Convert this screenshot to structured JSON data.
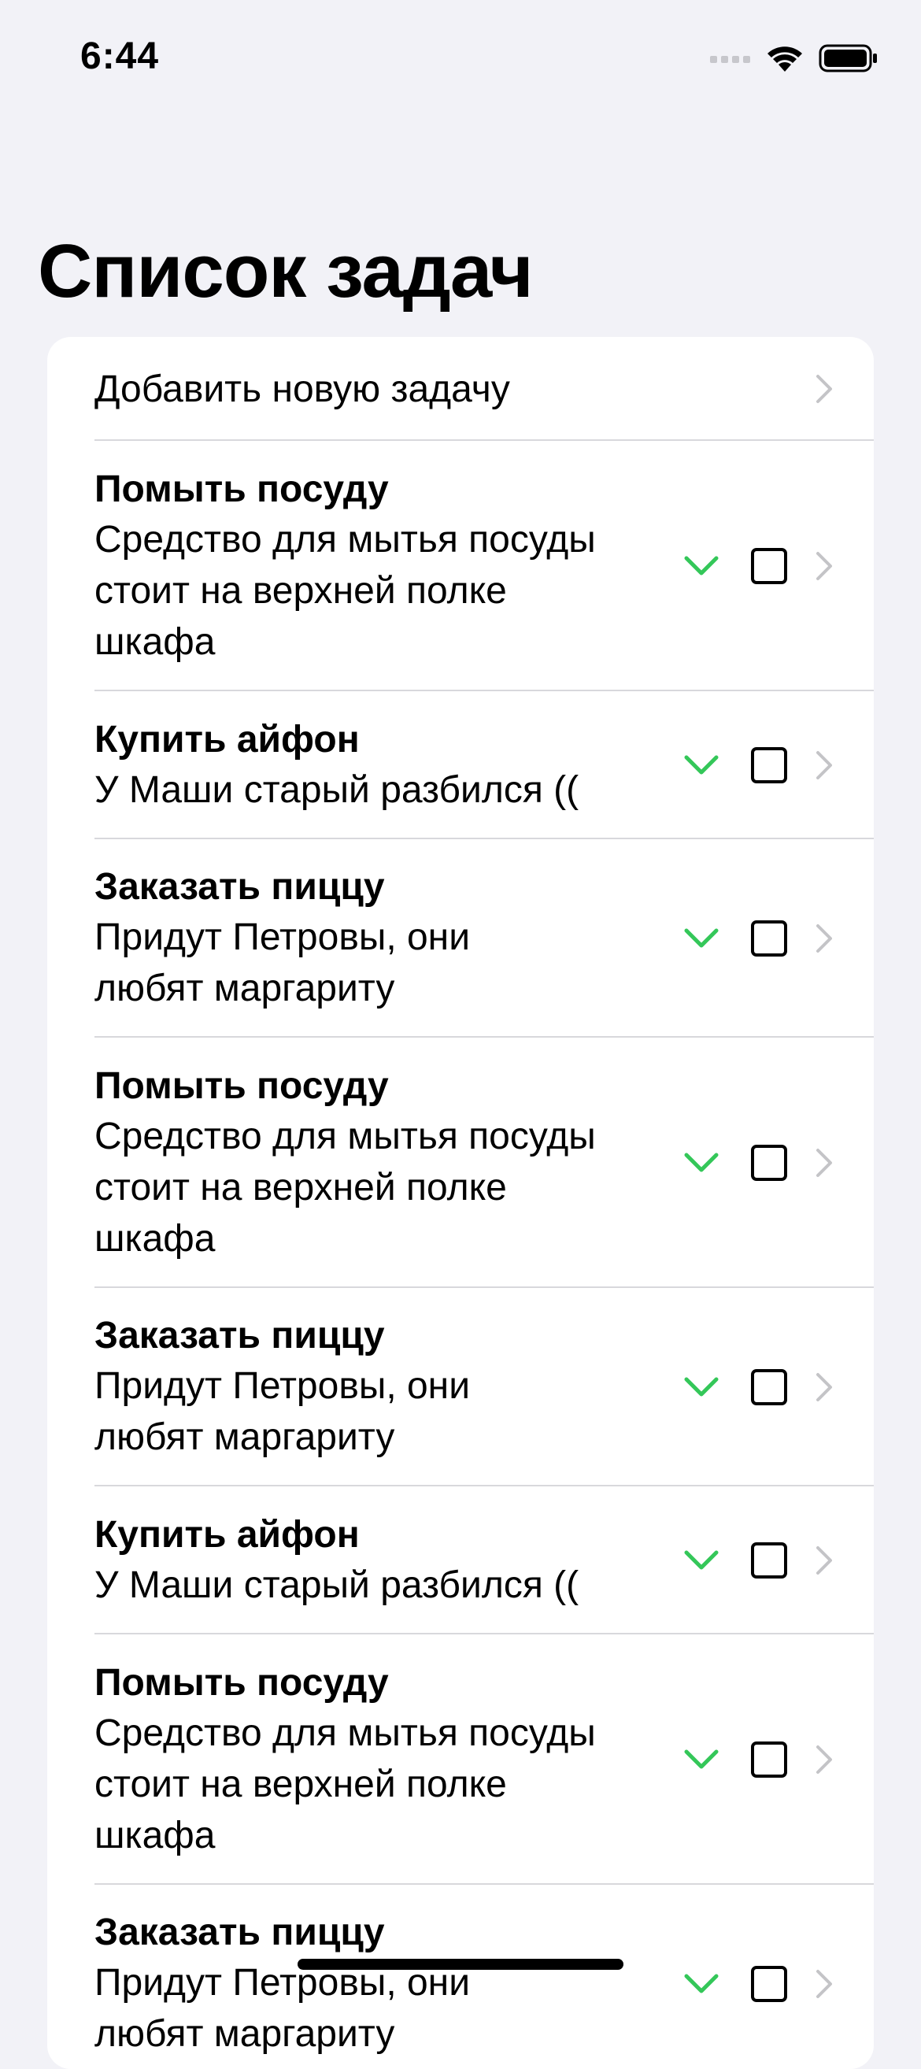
{
  "status_bar": {
    "time": "6:44"
  },
  "page": {
    "title": "Список задач"
  },
  "list": {
    "add_label": "Добавить новую задачу",
    "tasks": [
      {
        "title": "Помыть посуду",
        "description": "Средство для мытья посуды\nстоит на верхней полке\nшкафа",
        "checked": false
      },
      {
        "title": "Купить айфон",
        "description": "У Маши старый разбился ((",
        "checked": false
      },
      {
        "title": "Заказать пиццу",
        "description": "Придут Петровы, они\nлюбят маргариту",
        "checked": false
      },
      {
        "title": "Помыть посуду",
        "description": "Средство для мытья посуды\nстоит на верхней полке\nшкафа",
        "checked": false
      },
      {
        "title": "Заказать пиццу",
        "description": "Придут Петровы, они\nлюбят маргариту",
        "checked": false
      },
      {
        "title": "Купить айфон",
        "description": "У Маши старый разбился ((",
        "checked": false
      },
      {
        "title": "Помыть посуду",
        "description": "Средство для мытья посуды\nстоит на верхней полке\nшкафа",
        "checked": false
      },
      {
        "title": "Заказать пиццу",
        "description": "Придут Петровы, они\nлюбят маргариту",
        "checked": false
      }
    ]
  },
  "colors": {
    "accent_green": "#34c759",
    "chevron_gray": "#c4c4c7",
    "background": "#f2f2f7"
  },
  "icons": {
    "expand": "chevron-down-icon",
    "disclosure": "chevron-right-icon",
    "done": "checkbox"
  }
}
